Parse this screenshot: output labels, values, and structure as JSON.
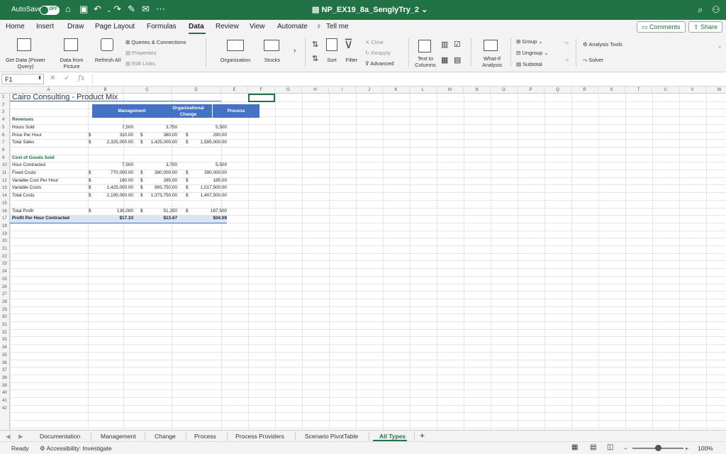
{
  "titlebar": {
    "autosave_label": "AutoSave",
    "autosave_state": "OFF",
    "document_title": "NP_EX19_8a_SenglyTry_2",
    "accent": "#217346"
  },
  "ribbon_tabs": [
    "Home",
    "Insert",
    "Draw",
    "Page Layout",
    "Formulas",
    "Data",
    "Review",
    "View",
    "Automate"
  ],
  "active_tab": "Data",
  "tell_me": "Tell me",
  "comments_label": "Comments",
  "share_label": "Share",
  "ribbon": {
    "get_data": "Get Data (Power Query)",
    "data_from_picture": "Data from Picture",
    "refresh_all": "Refresh All",
    "queries_connections": "Queries & Connections",
    "properties": "Properties",
    "edit_links": "Edit Links",
    "organization": "Organization",
    "stocks": "Stocks",
    "sort": "Sort",
    "filter": "Filter",
    "clear": "Clear",
    "reapply": "Reapply",
    "advanced": "Advanced",
    "text_to_columns": "Text to Columns",
    "what_if": "What-If Analysis",
    "group": "Group",
    "ungroup": "Ungroup",
    "subtotal": "Subtotal",
    "analysis_tools": "Analysis Tools",
    "solver": "Solver"
  },
  "name_box": "F1",
  "formula_fx": "fx",
  "columns": [
    "A",
    "B",
    "C",
    "D",
    "E",
    "F",
    "G",
    "H",
    "I",
    "J",
    "K",
    "L",
    "M",
    "N",
    "O",
    "P",
    "Q",
    "R",
    "S",
    "T",
    "U",
    "V",
    "W"
  ],
  "rows": [
    "1",
    "2",
    "3",
    "4",
    "5",
    "6",
    "7",
    "8",
    "9",
    "10",
    "11",
    "12",
    "13",
    "14",
    "15",
    "16",
    "17",
    "18",
    "19",
    "20",
    "21",
    "22",
    "23",
    "24",
    "25",
    "26",
    "27",
    "28",
    "29",
    "30",
    "31",
    "32",
    "33",
    "34",
    "35",
    "36",
    "37",
    "38",
    "39",
    "40",
    "41",
    "42"
  ],
  "sheet": {
    "title": "Cairo Consulting - Product Mix",
    "headers": [
      "Management",
      "Organizational Change",
      "Process"
    ],
    "revenues_label": "Revenues",
    "cost_label": "Cost of Goods Sold",
    "rows": [
      {
        "label": "Hours Sold",
        "d1": "",
        "v1": "7,500",
        "d2": "",
        "v2": "3,750",
        "d3": "",
        "v3": "5,500"
      },
      {
        "label": "Price Per Hour",
        "d1": "$",
        "v1": "310.00",
        "d2": "$",
        "v2": "380.00",
        "d3": "$",
        "v3": "290.00"
      },
      {
        "label": "Total Sales",
        "d1": "$",
        "v1": "2,325,000.00",
        "d2": "$",
        "v2": "1,425,000.00",
        "d3": "$",
        "v3": "1,595,000.00"
      },
      {
        "label": "Hour Contracted",
        "d1": "",
        "v1": "7,500",
        "d2": "",
        "v2": "3,750",
        "d3": "",
        "v3": "5,500"
      },
      {
        "label": "Fixed Costs",
        "d1": "$",
        "v1": "770,000.00",
        "d2": "$",
        "v2": "380,000.00",
        "d3": "$",
        "v3": "390,000.00"
      },
      {
        "label": "Variable Cost Per Hour",
        "d1": "$",
        "v1": "190.00",
        "d2": "$",
        "v2": "265.00",
        "d3": "$",
        "v3": "185.00"
      },
      {
        "label": "Variable Costs",
        "d1": "$",
        "v1": "1,425,000.00",
        "d2": "$",
        "v2": "993,750.00",
        "d3": "$",
        "v3": "1,017,500.00"
      },
      {
        "label": "Total Costs",
        "d1": "$",
        "v1": "2,195,000.00",
        "d2": "$",
        "v2": "1,373,750.00",
        "d3": "$",
        "v3": "1,407,500.00"
      },
      {
        "label": "Total Profit",
        "d1": "$",
        "v1": "130,000",
        "d2": "$",
        "v2": "51,250",
        "d3": "$",
        "v3": "187,500"
      },
      {
        "label": "Profit Per Hour Contracted",
        "d1": "",
        "v1": "$17.33",
        "d2": "",
        "v2": "$13.67",
        "d3": "",
        "v3": "$34.09"
      }
    ]
  },
  "sheet_tabs": [
    "Documentation",
    "Management",
    "Change",
    "Process",
    "Process Providers",
    "Scenario PivotTable",
    "All Types"
  ],
  "active_sheet": "All Types",
  "status": {
    "ready": "Ready",
    "accessibility": "Accessibility: Investigate",
    "zoom": "100%",
    "zoom_fraction": 0.5
  }
}
